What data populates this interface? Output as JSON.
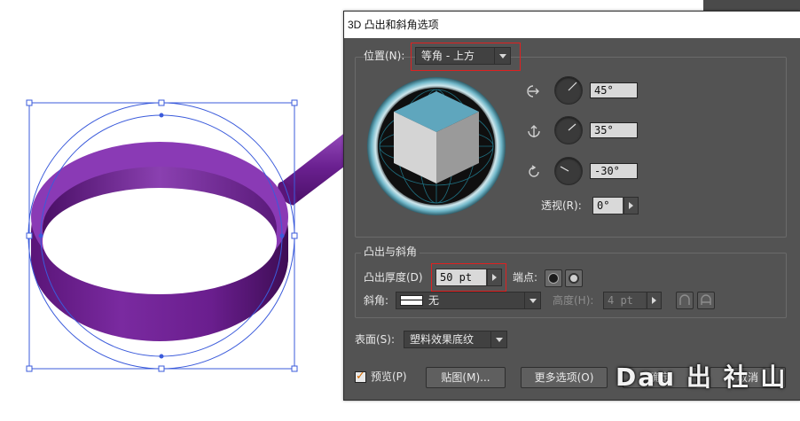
{
  "dialog": {
    "title": "3D 凸出和斜角选项",
    "position": {
      "label": "位置(N):",
      "value": "等角 - 上方",
      "rotation_x": "45°",
      "rotation_y": "35°",
      "rotation_z": "-30°",
      "perspective_label": "透视(R):",
      "perspective_value": "0°"
    },
    "extrude": {
      "group_label": "凸出与斜角",
      "depth_label": "凸出厚度(D)",
      "depth_value": "50 pt",
      "cap_label": "端点:",
      "bevel_label": "斜角:",
      "bevel_value": "无",
      "height_label": "高度(H):",
      "height_value": "4 pt"
    },
    "surface": {
      "label": "表面(S):",
      "value": "塑料效果底纹"
    },
    "footer": {
      "preview_label": "预览(P)",
      "preview_checked": true,
      "map_button": "贴图(M)...",
      "more_options_button": "更多选项(O)",
      "ok_button": "确定",
      "cancel_button": "取消"
    }
  },
  "watermark": "Dau 出 社 山",
  "colors": {
    "dialog_bg": "#535353",
    "ring_purple": "#6b1a8a",
    "selection_blue": "#3b5bdb",
    "highlight_red": "#e02020",
    "cube_top": "#5fa6bd"
  }
}
